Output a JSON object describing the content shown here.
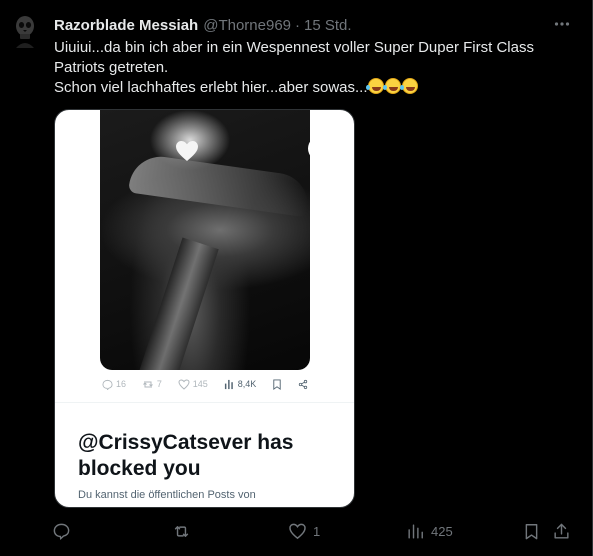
{
  "author": {
    "name": "Razorblade Messiah",
    "handle": "@Thorne969",
    "separator": "·",
    "time": "15 Std."
  },
  "tweet": {
    "line1": "Uiuiui...da bin ich aber in ein Wespennest voller Super Duper First Class",
    "line2": "Patriots getreten.",
    "line3": "Schon viel lachhaftes erlebt hier...aber sowas...",
    "emojis": [
      "rolling-on-floor-laughing",
      "rolling-on-floor-laughing",
      "rolling-on-floor-laughing"
    ]
  },
  "media": {
    "stats": {
      "replies": "16",
      "reposts": "7",
      "likes": "145",
      "views": "8,4K"
    },
    "blocked_title": "@CrissyCatsever has blocked you",
    "blocked_subtitle": "Du kannst die öffentlichen Posts von"
  },
  "actions": {
    "replies": "",
    "reposts": "",
    "likes": "1",
    "views": "425"
  },
  "colors": {
    "background": "#000000",
    "text": "#e7e9ea",
    "muted": "#71767b",
    "download_green": "#5cb82e"
  }
}
